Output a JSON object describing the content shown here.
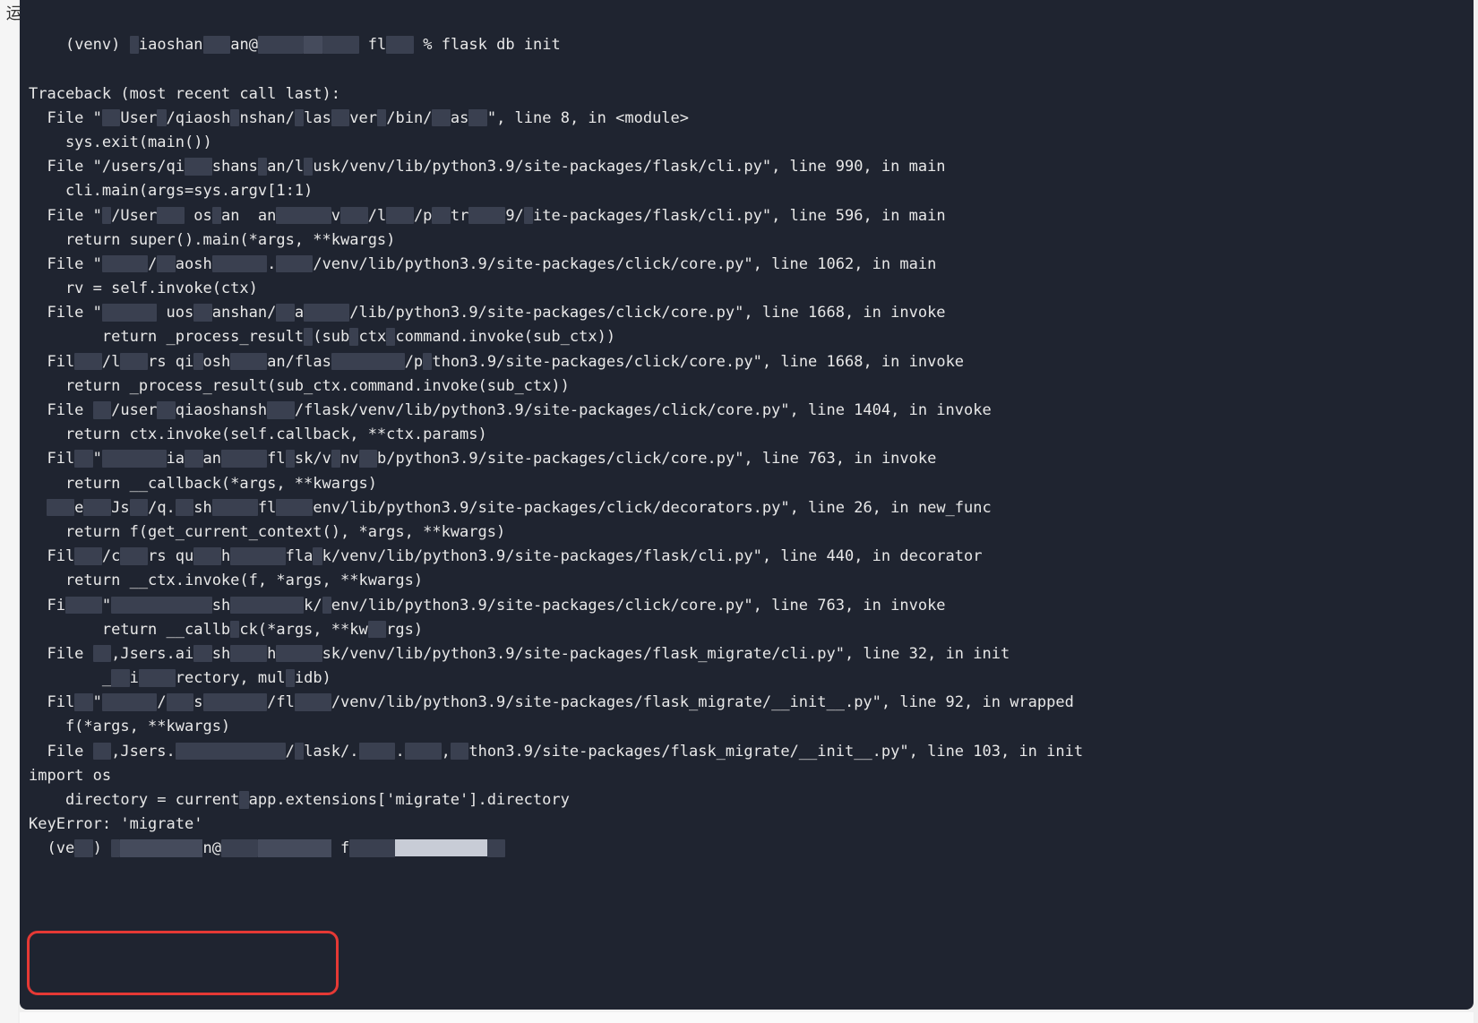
{
  "left_label": "运",
  "prompt": {
    "venv": "(venv)",
    "user_partial": "iaoshan",
    "host_partial": "an@",
    "path_partial": "fl",
    "percent": "%",
    "command": "flask db init"
  },
  "traceback_header": "Traceback (most recent call last):",
  "frames": [
    {
      "file_prefix": "File \"",
      "path_visible_1": "User",
      "path_visible_2": "/qiaosh",
      "path_visible_3": "nshan/",
      "path_visible_4": "las",
      "path_visible_5": "ver",
      "path_visible_6": "/bin/",
      "path_visible_7": "as",
      "suffix": "\", line 8, in <module>",
      "code": "sys.exit(main())"
    },
    {
      "file_prefix": "File \"/",
      "path": "users/qi   shans an/l.usk/venv/lib/python3.9/site-packages/flask/cli.py",
      "suffix": "\", line 990, in main",
      "code": "cli.main(args=sys.argv[1:1)"
    },
    {
      "file_prefix": "File \"",
      "path": "/User    os an  an       v   /l   /p  tr    9/ ite-packages/flask/cli.py",
      "suffix": "\", line 596, in main",
      "code": "return super().main(*args, **kwargs)"
    },
    {
      "file_prefix": "File \"",
      "path": "     /  aosh      .    /venv/lib/python3.9/site-packages/click/core.py",
      "suffix": "\", line 1062, in main",
      "code": "rv = self.invoke(ctx)"
    },
    {
      "file_prefix": "File \"",
      "path": "/User   uos  anshan/  a   /venv/lib/python3.9/site-packages/click/core.py",
      "suffix": "\", line 1668, in invoke",
      "code": "return _process_result(sub ctx command.invoke(sub_ctx))"
    },
    {
      "file_prefix": "Fil",
      "path": "/L   rs qi osh    an/flas        /p thon3.9/site-packages/click/core.py",
      "suffix": "\", line 1668, in invoke",
      "code": "return _process_result(sub_ctx.command.invoke(sub_ctx))"
    },
    {
      "file_prefix": "File ",
      "path": "/user  qiaoshansh  ./flask/venv/lib/python3.9/site-packages/click/core.py",
      "suffix": "\", line 1404, in invoke",
      "code": "return ctx.invoke(self.callback, **ctx.params)"
    },
    {
      "file_prefix": "Fil",
      "path": "\"       ia  an     fl sk/v nv  b/python3.9/site-packages/click/core.py",
      "suffix": "\", line 763, in invoke",
      "code": "return __callback(*args, **kwargs)"
    },
    {
      "file_prefix": "   e   Js  /q.  sh     fl    env/lib/python3.9/site-packages/click/decorators.py",
      "suffix": "\", line 26, in new_func",
      "code": "return f(get_current_context(), *args, **kwargs)"
    },
    {
      "file_prefix": "Fil",
      "path": "  /c  rs qu   h      fla k/venv/lib/python3.9/site-packages/flask/cli.py",
      "suffix": "\", line 440, in decorator",
      "code": "return __ctx.invoke(f, *args, **kwargs)"
    },
    {
      "file_prefix": "Fi",
      "path": "\"           sh        k/ env/lib/python3.9/site-packages/click/core.py",
      "suffix": "\", line 763, in invoke",
      "code": "return __callb ck(*args, **kw  rgs)"
    },
    {
      "file_prefix": "File ",
      "path": " ,users.ai  sh    h     sk/venv/lib/python3.9/site-packages/flask_migrate/cli.py",
      "suffix": "\", line 32, in init",
      "code": "_  i    rectory, mul idb)"
    },
    {
      "file_prefix": "Fil",
      "path": "\"      /   s       /fl    /venv/lib/python3.9/site-packages/flask_migrate/__init__.py",
      "suffix": "\", line 92, in wrapped",
      "code": "f(*args, **kwargs)"
    },
    {
      "file_prefix": "File ",
      "path": " ,Jsers.            / lask/.    .    ,  thon3.9/site-packages/flask_migrate/__init__.py",
      "suffix": "\", line 103, in init",
      "code": ""
    }
  ],
  "import_line": "import os",
  "directory_line": "directory = current_app.extensions['migrate'].directory",
  "error_line": "KeyError: 'migrate'",
  "bottom_prompt": {
    "venv": "(ve  )",
    "at": "n@",
    "mid": "f"
  }
}
